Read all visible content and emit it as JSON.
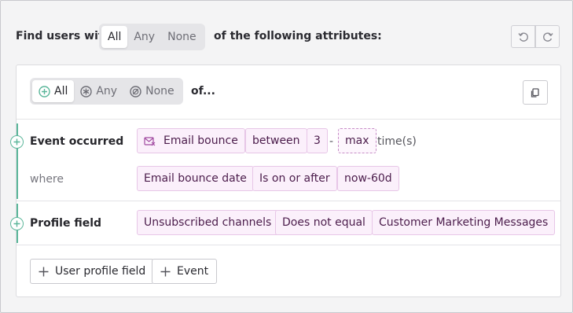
{
  "header": {
    "prefix": "Find users with",
    "match_options": [
      "All",
      "Any",
      "None"
    ],
    "selected": "All",
    "suffix": "of the following attributes:"
  },
  "group": {
    "match_options": [
      "All",
      "Any",
      "None"
    ],
    "selected": "All",
    "suffix": "of..."
  },
  "conditions": [
    {
      "label": "Event occurred",
      "chips": [
        "Email bounce",
        "between",
        "3",
        "-",
        "max",
        "time(s)"
      ],
      "where_label": "where",
      "where_chips": [
        "Email bounce date",
        "Is on or after",
        "now-60d"
      ]
    },
    {
      "label": "Profile field",
      "chips": [
        "Unsubscribed channels",
        "Does not equal",
        "Customer Marketing Messages"
      ]
    }
  ],
  "add_buttons": [
    "User profile field",
    "Event"
  ],
  "colors": {
    "accent_green": "#5bb69a",
    "chip_bg": "#fbf0fb",
    "chip_border": "#e7c6e7",
    "chip_text": "#4b1c4b"
  },
  "icons": [
    "undo-icon",
    "redo-icon",
    "copy-icon",
    "plus-circle-icon",
    "asterisk-circle-icon",
    "none-circle-icon",
    "email-icon",
    "plus-icon"
  ]
}
